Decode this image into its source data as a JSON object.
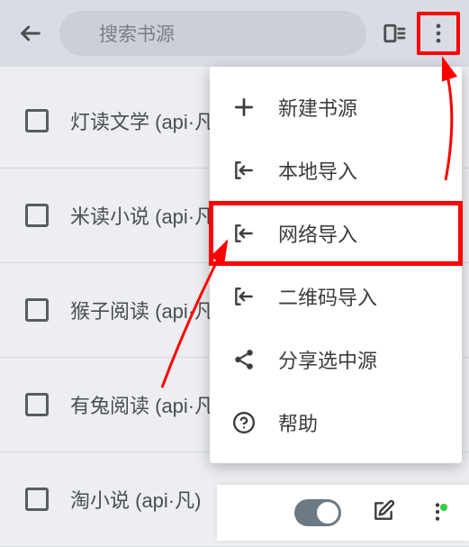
{
  "topbar": {
    "search_placeholder": "搜索书源"
  },
  "list": {
    "items": [
      {
        "label": "灯读文学 (api·凡)"
      },
      {
        "label": "米读小说 (api·凡)"
      },
      {
        "label": "猴子阅读 (api·凡)"
      },
      {
        "label": "有兔阅读 (api·凡)"
      },
      {
        "label": "淘小说 (api·凡)"
      }
    ]
  },
  "menu": {
    "new": "新建书源",
    "local_import": "本地导入",
    "web_import": "网络导入",
    "qr_import": "二维码导入",
    "share": "分享选中源",
    "help": "帮助"
  }
}
